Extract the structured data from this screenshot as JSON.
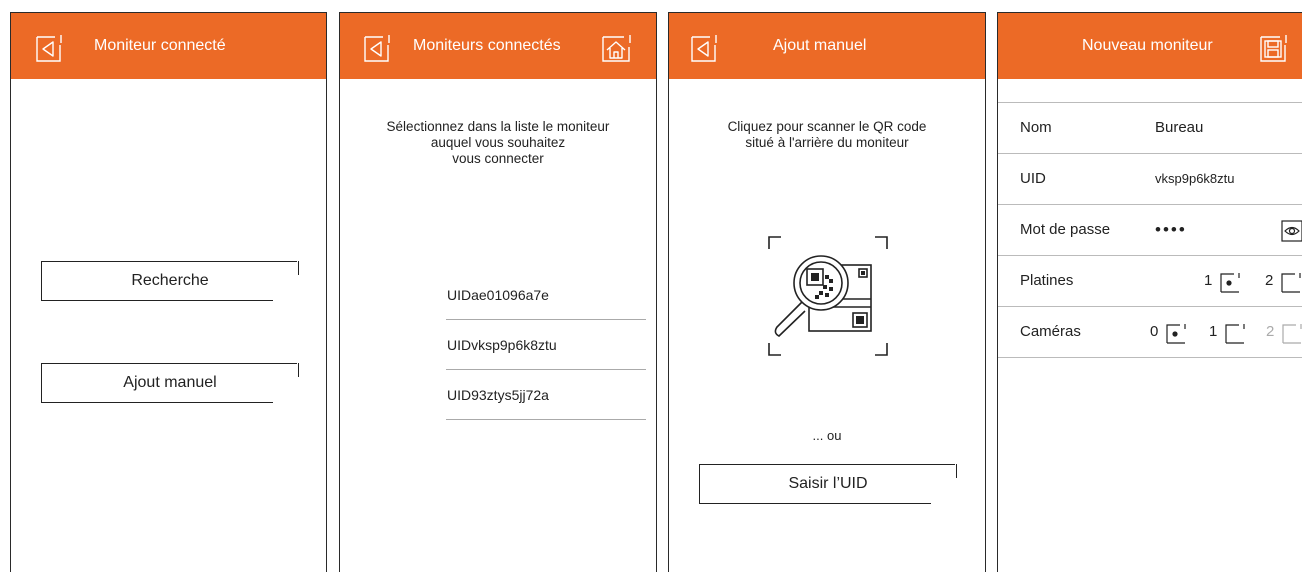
{
  "colors": {
    "header": "#ec6a26",
    "text": "#222222"
  },
  "screen1": {
    "title": "Moniteur connecté",
    "back_icon": "back-icon",
    "search_button": "Recherche",
    "manual_button": "Ajout manuel"
  },
  "screen2": {
    "title": "Moniteurs connectés",
    "back_icon": "back-icon",
    "home_icon": "home-icon",
    "instruction": "Sélectionnez dans la liste le moniteur\nauquel vous souhaitez\nvous connecter",
    "items": [
      "UIDae01096a7e",
      "UIDvksp9p6k8ztu",
      "UID93ztys5jj72a"
    ]
  },
  "screen3": {
    "title": "Ajout manuel",
    "back_icon": "back-icon",
    "instruction": "Cliquez pour scanner le QR code\nsitué à l'arrière du moniteur",
    "qr_icon": "qr-scan-icon",
    "or_text": "... ou",
    "enter_uid_button": "Saisir l’UID"
  },
  "screen4": {
    "title": "Nouveau moniteur",
    "save_icon": "save-icon",
    "name_label": "Nom",
    "name_value": "Bureau",
    "uid_label": "UID",
    "uid_value": "vksp9p6k8ztu",
    "password_label": "Mot de passe",
    "password_value": "••••",
    "eye_icon": "eye-icon",
    "platines_label": "Platines",
    "platines_options": [
      "1",
      "2"
    ],
    "platines_selected": "1",
    "cameras_label": "Caméras",
    "cameras_options": [
      "0",
      "1",
      "2"
    ],
    "cameras_selected": "0"
  }
}
